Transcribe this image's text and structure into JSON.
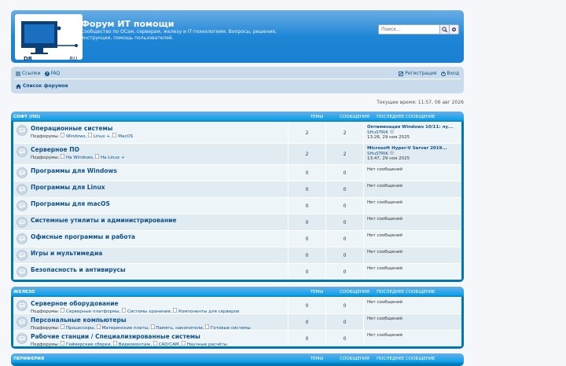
{
  "header": {
    "logo_left": "DR",
    "logo_right": ".RU",
    "title": "Форум ИТ помощи",
    "description": "Сообщество по ОСам, серверам, железу и IT-технологиям. Вопросы, решения, инструкции, помощь пользователей.",
    "search_placeholder": "Поиск…"
  },
  "nav": {
    "links": "Ссылки",
    "faq": "FAQ",
    "register": "Регистрация",
    "login": "Вход",
    "breadcrumb": "Список форумов"
  },
  "time": "Текущее время: 11:57, 06 авг 2026",
  "columns": {
    "topics": "Темы",
    "posts": "Сообщения",
    "last": "Последнее сообщение"
  },
  "sections": [
    {
      "title": "Софт (ПО)",
      "forums": [
        {
          "title": "Операционные системы",
          "sub_label": "Подфорумы:",
          "subs": [
            "Windows,",
            "Linux +,",
            "MacOS"
          ],
          "topics": "2",
          "posts": "2",
          "last_title": "Оптимизация Windows 10/11: лу...",
          "last_user": "SHuSTRIK",
          "last_date": "13:26, 29 ноя 2025"
        },
        {
          "title": "Серверное ПО",
          "sub_label": "Подфорумы:",
          "subs": [
            "На Windows,",
            "На Linux +"
          ],
          "topics": "2",
          "posts": "2",
          "last_title": "Microsoft Hyper-V Server 2019...",
          "last_user": "SHuSTRIK",
          "last_date": "13:47, 29 ноя 2025"
        },
        {
          "title": "Программы для Windows",
          "topics": "0",
          "posts": "0",
          "last_none": "Нет сообщений"
        },
        {
          "title": "Программы для Linux",
          "topics": "0",
          "posts": "0",
          "last_none": "Нет сообщений"
        },
        {
          "title": "Программы для macOS",
          "topics": "0",
          "posts": "0",
          "last_none": "Нет сообщений"
        },
        {
          "title": "Системные утилиты и администрирование",
          "topics": "0",
          "posts": "0",
          "last_none": "Нет сообщений"
        },
        {
          "title": "Офисные программы и работа",
          "topics": "0",
          "posts": "0",
          "last_none": "Нет сообщений"
        },
        {
          "title": "Игры и мультимедиа",
          "topics": "0",
          "posts": "0",
          "last_none": "Нет сообщений"
        },
        {
          "title": "Безопасность и антивирусы",
          "topics": "0",
          "posts": "0",
          "last_none": "Нет сообщений"
        }
      ]
    },
    {
      "title": "Железо",
      "forums": [
        {
          "title": "Серверное оборудование",
          "sub_label": "Подфорумы:",
          "subs": [
            "Серверные платформы,",
            "Системы хранения,",
            "Компоненты для серверов"
          ],
          "topics": "0",
          "posts": "0",
          "last_none": "Нет сообщений"
        },
        {
          "title": "Персональные компьютеры",
          "sub_label": "Подфорумы:",
          "subs": [
            "Процессоры,",
            "Материнские платы,",
            "Память, накопители,",
            "Готовые системы"
          ],
          "topics": "0",
          "posts": "0",
          "last_none": "Нет сообщений"
        },
        {
          "title": "Рабочие станции / Специализированные системы",
          "sub_label": "Подфорумы:",
          "subs": [
            "Геймерские сборки,",
            "Видеомонтаж,",
            "CAD/CAM,",
            "Научные расчёты"
          ],
          "topics": "0",
          "posts": "0",
          "last_none": "Нет сообщений"
        }
      ]
    },
    {
      "title": "Периферия",
      "forums": []
    }
  ]
}
